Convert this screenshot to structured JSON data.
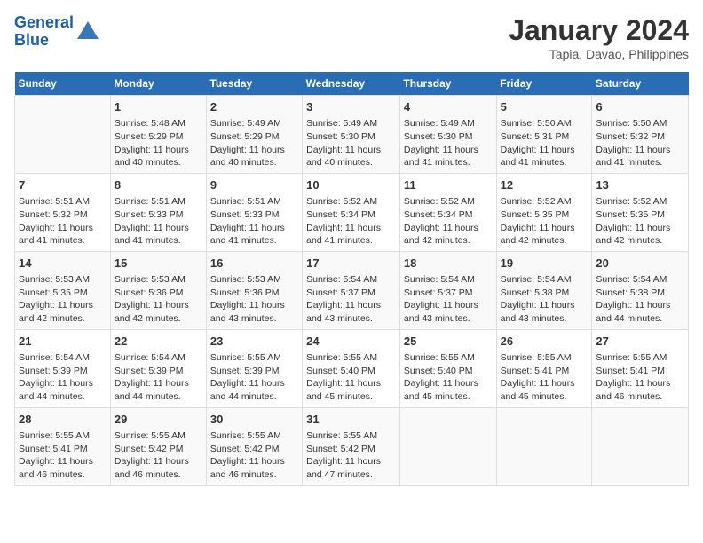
{
  "header": {
    "logo_line1": "General",
    "logo_line2": "Blue",
    "title": "January 2024",
    "subtitle": "Tapia, Davao, Philippines"
  },
  "days_of_week": [
    "Sunday",
    "Monday",
    "Tuesday",
    "Wednesday",
    "Thursday",
    "Friday",
    "Saturday"
  ],
  "weeks": [
    [
      {
        "day": "",
        "info": ""
      },
      {
        "day": "1",
        "info": "Sunrise: 5:48 AM\nSunset: 5:29 PM\nDaylight: 11 hours and 40 minutes."
      },
      {
        "day": "2",
        "info": "Sunrise: 5:49 AM\nSunset: 5:29 PM\nDaylight: 11 hours and 40 minutes."
      },
      {
        "day": "3",
        "info": "Sunrise: 5:49 AM\nSunset: 5:30 PM\nDaylight: 11 hours and 40 minutes."
      },
      {
        "day": "4",
        "info": "Sunrise: 5:49 AM\nSunset: 5:30 PM\nDaylight: 11 hours and 41 minutes."
      },
      {
        "day": "5",
        "info": "Sunrise: 5:50 AM\nSunset: 5:31 PM\nDaylight: 11 hours and 41 minutes."
      },
      {
        "day": "6",
        "info": "Sunrise: 5:50 AM\nSunset: 5:32 PM\nDaylight: 11 hours and 41 minutes."
      }
    ],
    [
      {
        "day": "7",
        "info": "Sunrise: 5:51 AM\nSunset: 5:32 PM\nDaylight: 11 hours and 41 minutes."
      },
      {
        "day": "8",
        "info": "Sunrise: 5:51 AM\nSunset: 5:33 PM\nDaylight: 11 hours and 41 minutes."
      },
      {
        "day": "9",
        "info": "Sunrise: 5:51 AM\nSunset: 5:33 PM\nDaylight: 11 hours and 41 minutes."
      },
      {
        "day": "10",
        "info": "Sunrise: 5:52 AM\nSunset: 5:34 PM\nDaylight: 11 hours and 41 minutes."
      },
      {
        "day": "11",
        "info": "Sunrise: 5:52 AM\nSunset: 5:34 PM\nDaylight: 11 hours and 42 minutes."
      },
      {
        "day": "12",
        "info": "Sunrise: 5:52 AM\nSunset: 5:35 PM\nDaylight: 11 hours and 42 minutes."
      },
      {
        "day": "13",
        "info": "Sunrise: 5:52 AM\nSunset: 5:35 PM\nDaylight: 11 hours and 42 minutes."
      }
    ],
    [
      {
        "day": "14",
        "info": "Sunrise: 5:53 AM\nSunset: 5:35 PM\nDaylight: 11 hours and 42 minutes."
      },
      {
        "day": "15",
        "info": "Sunrise: 5:53 AM\nSunset: 5:36 PM\nDaylight: 11 hours and 42 minutes."
      },
      {
        "day": "16",
        "info": "Sunrise: 5:53 AM\nSunset: 5:36 PM\nDaylight: 11 hours and 43 minutes."
      },
      {
        "day": "17",
        "info": "Sunrise: 5:54 AM\nSunset: 5:37 PM\nDaylight: 11 hours and 43 minutes."
      },
      {
        "day": "18",
        "info": "Sunrise: 5:54 AM\nSunset: 5:37 PM\nDaylight: 11 hours and 43 minutes."
      },
      {
        "day": "19",
        "info": "Sunrise: 5:54 AM\nSunset: 5:38 PM\nDaylight: 11 hours and 43 minutes."
      },
      {
        "day": "20",
        "info": "Sunrise: 5:54 AM\nSunset: 5:38 PM\nDaylight: 11 hours and 44 minutes."
      }
    ],
    [
      {
        "day": "21",
        "info": "Sunrise: 5:54 AM\nSunset: 5:39 PM\nDaylight: 11 hours and 44 minutes."
      },
      {
        "day": "22",
        "info": "Sunrise: 5:54 AM\nSunset: 5:39 PM\nDaylight: 11 hours and 44 minutes."
      },
      {
        "day": "23",
        "info": "Sunrise: 5:55 AM\nSunset: 5:39 PM\nDaylight: 11 hours and 44 minutes."
      },
      {
        "day": "24",
        "info": "Sunrise: 5:55 AM\nSunset: 5:40 PM\nDaylight: 11 hours and 45 minutes."
      },
      {
        "day": "25",
        "info": "Sunrise: 5:55 AM\nSunset: 5:40 PM\nDaylight: 11 hours and 45 minutes."
      },
      {
        "day": "26",
        "info": "Sunrise: 5:55 AM\nSunset: 5:41 PM\nDaylight: 11 hours and 45 minutes."
      },
      {
        "day": "27",
        "info": "Sunrise: 5:55 AM\nSunset: 5:41 PM\nDaylight: 11 hours and 46 minutes."
      }
    ],
    [
      {
        "day": "28",
        "info": "Sunrise: 5:55 AM\nSunset: 5:41 PM\nDaylight: 11 hours and 46 minutes."
      },
      {
        "day": "29",
        "info": "Sunrise: 5:55 AM\nSunset: 5:42 PM\nDaylight: 11 hours and 46 minutes."
      },
      {
        "day": "30",
        "info": "Sunrise: 5:55 AM\nSunset: 5:42 PM\nDaylight: 11 hours and 46 minutes."
      },
      {
        "day": "31",
        "info": "Sunrise: 5:55 AM\nSunset: 5:42 PM\nDaylight: 11 hours and 47 minutes."
      },
      {
        "day": "",
        "info": ""
      },
      {
        "day": "",
        "info": ""
      },
      {
        "day": "",
        "info": ""
      }
    ]
  ]
}
